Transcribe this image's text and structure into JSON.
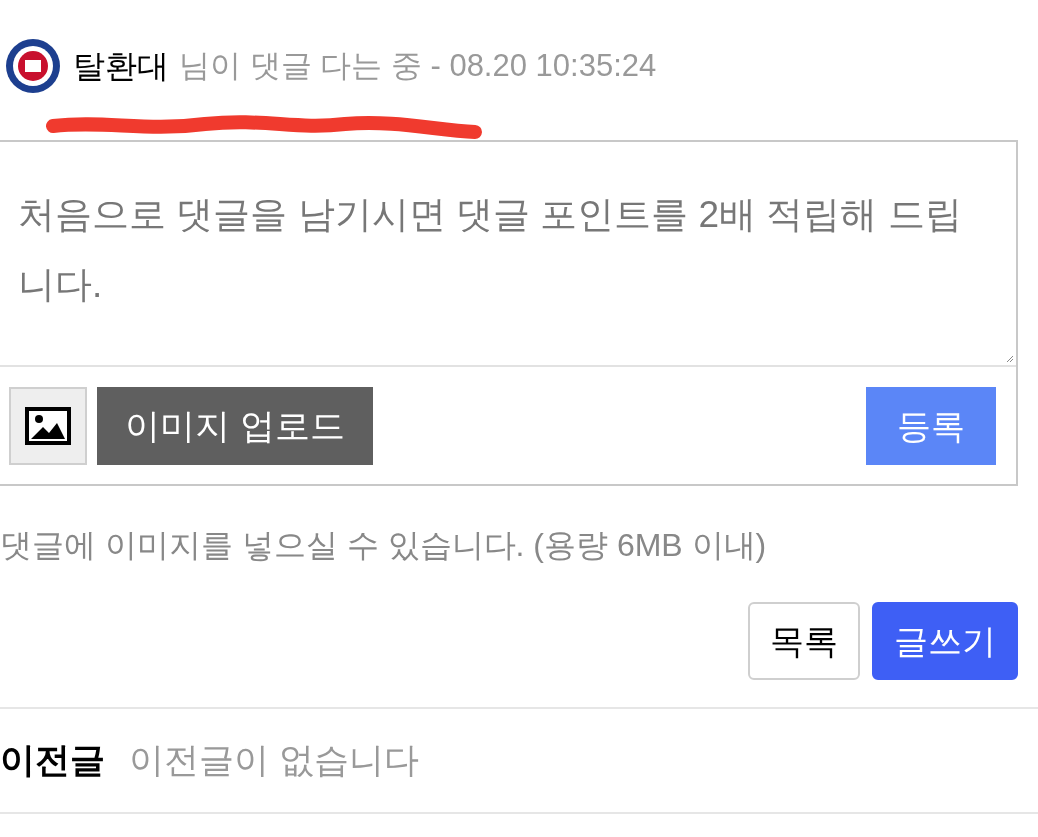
{
  "typing_status": {
    "user": "탈환대",
    "message": "님이 댓글 다는 중 - 08.20 10:35:24"
  },
  "comment_box": {
    "placeholder": "처음으로 댓글을 남기시면 댓글 포인트를 2배 적립해 드립니다.",
    "upload_button": "이미지 업로드",
    "submit_button": "등록"
  },
  "upload_note": "댓글에 이미지를 넣으실 수 있습니다. (용량 6MB 이내)",
  "actions": [
    {
      "label": "목록",
      "kind": "outline"
    },
    {
      "label": "글쓰기",
      "kind": "primary"
    }
  ],
  "prev_post": {
    "label": "이전글",
    "value": "이전글이 없습니다"
  }
}
